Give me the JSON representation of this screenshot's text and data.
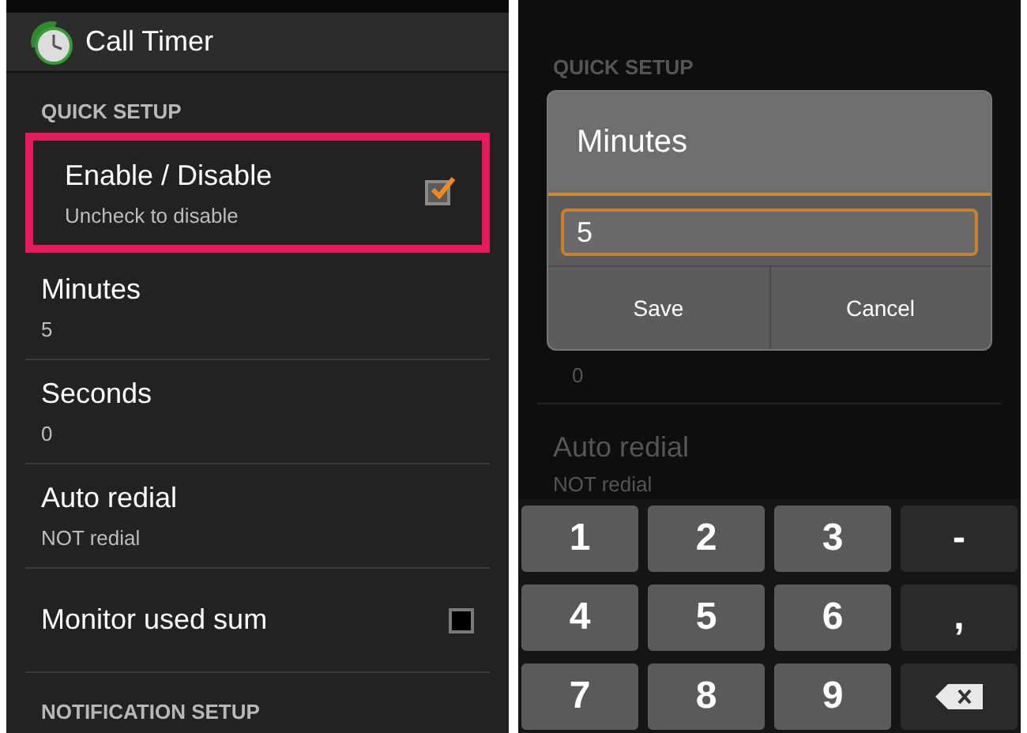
{
  "left_screen": {
    "app_title": "Call Timer",
    "sections": [
      {
        "header": "QUICK SETUP",
        "items": [
          {
            "kind": "checkbox",
            "title": "Enable / Disable",
            "summary": "Uncheck to disable",
            "checked": true,
            "highlighted": true
          },
          {
            "kind": "value",
            "title": "Minutes",
            "summary": "5",
            "highlighted": false
          },
          {
            "kind": "value",
            "title": "Seconds",
            "summary": "0",
            "highlighted": false
          },
          {
            "kind": "value",
            "title": "Auto redial",
            "summary": "NOT redial",
            "highlighted": false
          },
          {
            "kind": "checkbox",
            "title": "Monitor used sum",
            "checked": false,
            "highlighted": false
          }
        ]
      },
      {
        "header": "NOTIFICATION SETUP"
      }
    ]
  },
  "right_screen": {
    "background": {
      "section_header": "QUICK SETUP",
      "seconds_value": "0",
      "item_title": "Auto redial",
      "item_summary": "NOT redial"
    },
    "dialog": {
      "title": "Minutes",
      "value": "5",
      "buttons": [
        "Save",
        "Cancel"
      ]
    },
    "keypad": [
      {
        "kind": "digit",
        "label": "1"
      },
      {
        "kind": "digit",
        "label": "2"
      },
      {
        "kind": "digit",
        "label": "3"
      },
      {
        "kind": "symbol",
        "label": "-"
      },
      {
        "kind": "digit",
        "label": "4"
      },
      {
        "kind": "digit",
        "label": "5"
      },
      {
        "kind": "digit",
        "label": "6"
      },
      {
        "kind": "symbol",
        "label": ","
      },
      {
        "kind": "digit",
        "label": "7"
      },
      {
        "kind": "digit",
        "label": "8"
      },
      {
        "kind": "digit",
        "label": "9"
      },
      {
        "kind": "backspace"
      }
    ]
  }
}
